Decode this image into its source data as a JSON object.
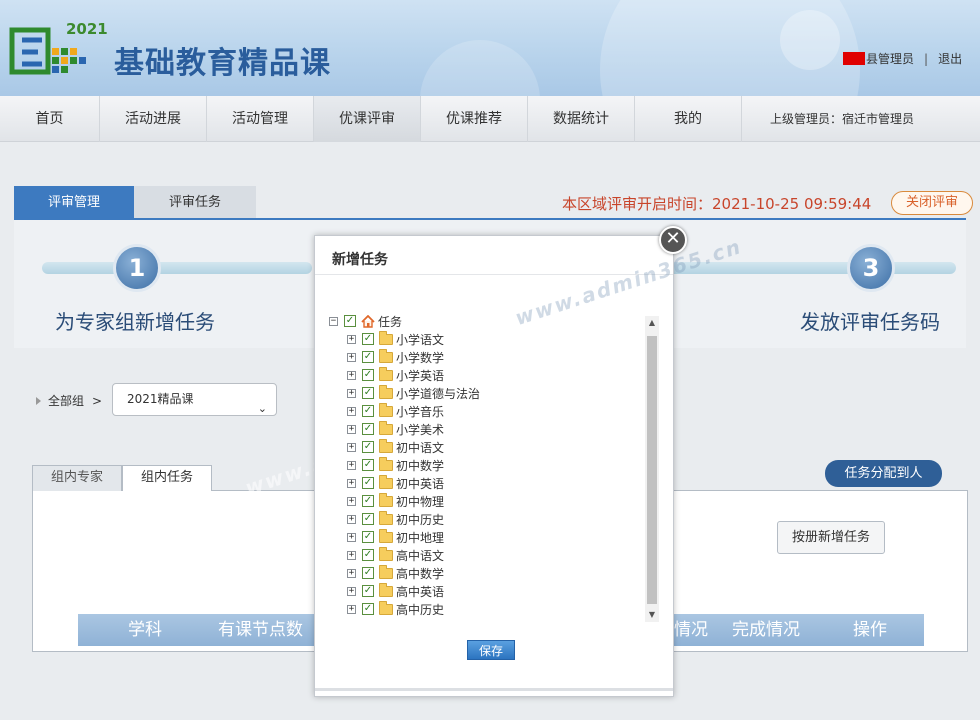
{
  "header": {
    "logo_year": "2021",
    "title": "基础教育精品课",
    "role": "县管理员",
    "separator": "|",
    "logout": "退出"
  },
  "nav": {
    "items": [
      "首页",
      "活动进展",
      "活动管理",
      "优课评审",
      "优课推荐",
      "数据统计",
      "我的"
    ],
    "active_index": 3,
    "superior": "上级管理员：宿迁市管理员"
  },
  "main_tabs": [
    "评审管理",
    "评审任务"
  ],
  "open_time": "本区域评审开启时间：2021-10-25 09:59:44",
  "close_review": "关闭评审",
  "steps": [
    {
      "number": "1",
      "label": "为专家组新增任务"
    },
    {
      "number": "3",
      "label": "发放评审任务码"
    }
  ],
  "crumb": {
    "all": "全部组",
    "arrow": ">"
  },
  "group_select": {
    "value": "2021精品课",
    "chevron": "⌄"
  },
  "inner_tabs": [
    "组内专家",
    "组内任务"
  ],
  "assign_button": "任务分配到人",
  "register_button": "按册新增任务",
  "table_headers": [
    "学科",
    "有课节点数",
    "情况",
    "完成情况",
    "操作"
  ],
  "watermark": [
    "www.admin365.cn",
    "www.admin365.cn"
  ],
  "modal": {
    "title": "新增任务",
    "close": "✕",
    "root": "任务",
    "expand_root": "−",
    "expand_item": "+",
    "check": "✓",
    "items": [
      "小学语文",
      "小学数学",
      "小学英语",
      "小学道德与法治",
      "小学音乐",
      "小学美术",
      "初中语文",
      "初中数学",
      "初中英语",
      "初中物理",
      "初中历史",
      "初中地理",
      "高中语文",
      "高中数学",
      "高中英语",
      "高中历史"
    ],
    "scroll_up": "▲",
    "scroll_down": "▼",
    "save": "保存"
  },
  "colors": {
    "accent": "#3d7ac0",
    "alert": "#c8452b",
    "brand": "#2a5d9c"
  }
}
